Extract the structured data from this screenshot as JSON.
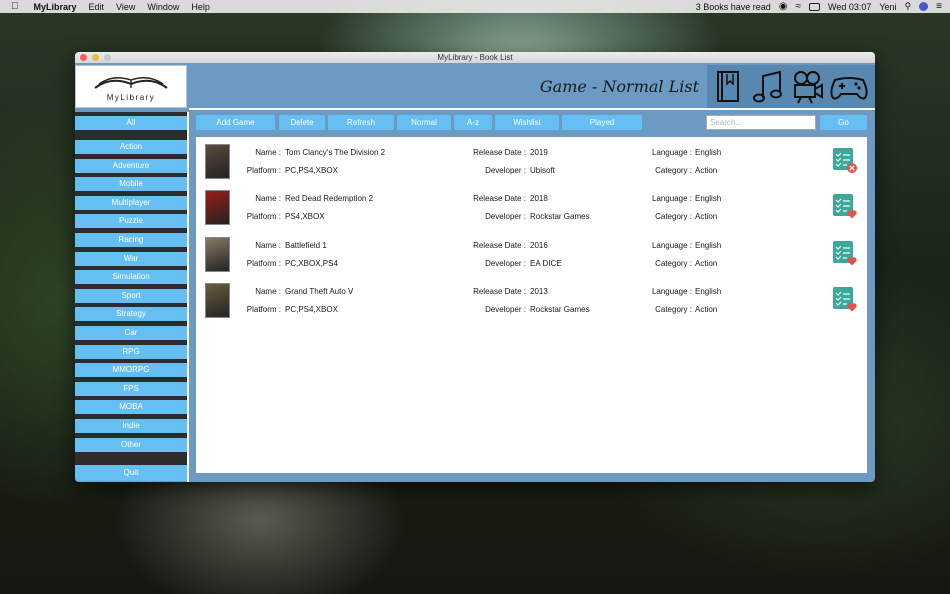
{
  "menubar": {
    "app_name": "MyLibrary",
    "menus": [
      "Edit",
      "View",
      "Window",
      "Help"
    ],
    "status_text": "3 Books have read",
    "clock": "Wed 03:07",
    "user": "Yeni"
  },
  "window": {
    "title": "MyLibrary - Book List"
  },
  "logo": {
    "text": "MyLibrary"
  },
  "header": {
    "title": "Game - Normal List"
  },
  "sidebar": {
    "all_label": "All",
    "categories": [
      "Action",
      "Adventure",
      "Mobile",
      "Multiplayer",
      "Puzzle",
      "Racing",
      "War",
      "Simulation",
      "Sport",
      "Strategy",
      "Car",
      "RPG",
      "MMORPG",
      "FPS",
      "MOBA",
      "Indie",
      "Other"
    ],
    "quit_label": "Quit"
  },
  "toolbar": {
    "add": "Add Game",
    "delete": "Delete",
    "refresh": "Refresh",
    "normal": "Normal",
    "az": "A-z",
    "wishlist": "Wishlist",
    "played": "Played",
    "search_placeholder": "Search...",
    "go": "Go"
  },
  "labels": {
    "name": "Name :",
    "platform": "Platform :",
    "release": "Release Date :",
    "developer": "Developer :",
    "language": "Language :",
    "category": "Category :"
  },
  "games": [
    {
      "name": "Tom Clancy's The Division 2",
      "platform": "PC,PS4,XBOX",
      "release": "2019",
      "developer": "Ubisoft",
      "language": "English",
      "category": "Action",
      "status_icon": "checklist-remove-icon",
      "cover_color": "#5b4a3a"
    },
    {
      "name": "Red Dead Redemption 2",
      "platform": "PS4,XBOX",
      "release": "2018",
      "developer": "Rockstar Games",
      "language": "English",
      "category": "Action",
      "status_icon": "checklist-heart-icon",
      "cover_color": "#9c1d16"
    },
    {
      "name": "Battlefield 1",
      "platform": "PC,XBOX,PS4",
      "release": "2016",
      "developer": "EA DICE",
      "language": "English",
      "category": "Action",
      "status_icon": "checklist-heart-icon",
      "cover_color": "#8a7a66"
    },
    {
      "name": "Grand Theft Auto V",
      "platform": "PC,PS4,XBOX",
      "release": "2013",
      "developer": "Rockstar Games",
      "language": "English",
      "category": "Action",
      "status_icon": "checklist-heart-icon",
      "cover_color": "#6b5d3e"
    }
  ],
  "colors": {
    "window_bg": "#6d9ac3",
    "button_bg": "#66bff2",
    "status_teal": "#3aa99a",
    "status_red": "#e2534a"
  }
}
